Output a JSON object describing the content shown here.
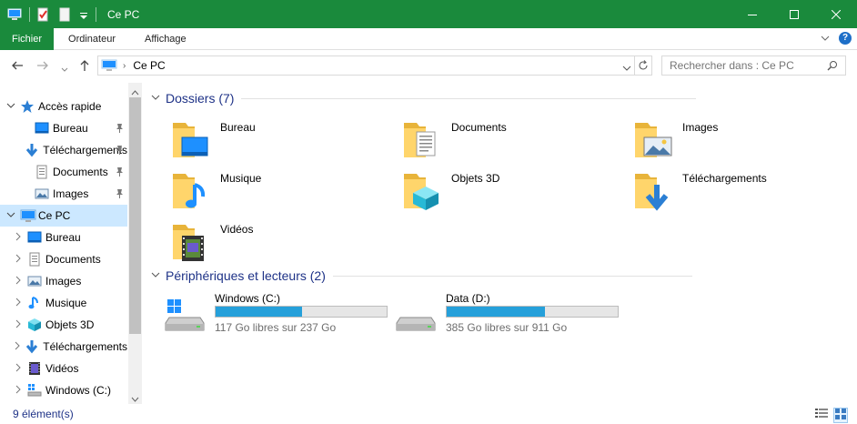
{
  "window": {
    "title": "Ce PC",
    "controls": [
      "minimize-icon",
      "maximize-icon",
      "close-icon"
    ]
  },
  "quick_access_toolbar": [
    "computer-icon",
    "properties-icon",
    "new-folder-icon",
    "customize-chevron-icon"
  ],
  "ribbon": {
    "tabs": [
      {
        "label": "Fichier",
        "active": true
      },
      {
        "label": "Ordinateur",
        "active": false
      },
      {
        "label": "Affichage",
        "active": false
      }
    ],
    "help": "?"
  },
  "address": {
    "path": "Ce PC",
    "search_placeholder": "Rechercher dans : Ce PC"
  },
  "nav": {
    "items": [
      {
        "label": "Accès rapide",
        "icon": "star-icon",
        "chevron": "v",
        "pinned": false,
        "indent": 0
      },
      {
        "label": "Bureau",
        "icon": "desktop-icon",
        "chevron": "",
        "pinned": true,
        "indent": 1
      },
      {
        "label": "Téléchargements",
        "icon": "download-icon",
        "chevron": "",
        "pinned": true,
        "indent": 1
      },
      {
        "label": "Documents",
        "icon": "document-icon",
        "chevron": "",
        "pinned": true,
        "indent": 1
      },
      {
        "label": "Images",
        "icon": "image-icon",
        "chevron": "",
        "pinned": true,
        "indent": 1
      },
      {
        "label": "Ce PC",
        "icon": "computer-icon",
        "chevron": "v",
        "pinned": false,
        "indent": 0,
        "selected": true
      },
      {
        "label": "Bureau",
        "icon": "desktop-icon",
        "chevron": ">",
        "pinned": false,
        "indent": 1
      },
      {
        "label": "Documents",
        "icon": "document-icon",
        "chevron": ">",
        "pinned": false,
        "indent": 1
      },
      {
        "label": "Images",
        "icon": "image-icon",
        "chevron": ">",
        "pinned": false,
        "indent": 1
      },
      {
        "label": "Musique",
        "icon": "music-icon",
        "chevron": ">",
        "pinned": false,
        "indent": 1
      },
      {
        "label": "Objets 3D",
        "icon": "cube-icon",
        "chevron": ">",
        "pinned": false,
        "indent": 1
      },
      {
        "label": "Téléchargements",
        "icon": "download-icon",
        "chevron": ">",
        "pinned": false,
        "indent": 1
      },
      {
        "label": "Vidéos",
        "icon": "video-icon",
        "chevron": ">",
        "pinned": false,
        "indent": 1
      },
      {
        "label": "Windows (C:)",
        "icon": "drive-icon",
        "chevron": ">",
        "pinned": false,
        "indent": 1
      }
    ]
  },
  "content": {
    "folders_header": "Dossiers (7)",
    "folders": [
      {
        "name": "Bureau",
        "icon": "desktop-folder-icon"
      },
      {
        "name": "Documents",
        "icon": "documents-folder-icon"
      },
      {
        "name": "Images",
        "icon": "images-folder-icon"
      },
      {
        "name": "Musique",
        "icon": "music-folder-icon"
      },
      {
        "name": "Objets 3D",
        "icon": "3d-objects-folder-icon"
      },
      {
        "name": "Téléchargements",
        "icon": "downloads-folder-icon"
      },
      {
        "name": "Vidéos",
        "icon": "videos-folder-icon"
      }
    ],
    "drives_header": "Périphériques et lecteurs (2)",
    "drives": [
      {
        "name": "Windows (C:)",
        "free": "117 Go libres sur 237 Go",
        "used_fraction": 0.506,
        "icon": "windows-drive-icon"
      },
      {
        "name": "Data (D:)",
        "free": "385 Go libres sur 911 Go",
        "used_fraction": 0.577,
        "icon": "data-drive-icon"
      }
    ]
  },
  "status": {
    "count": "9 élément(s)"
  },
  "colors": {
    "titlebar": "#1a8a3c",
    "selection": "#cce8ff",
    "group_header": "#1e3287",
    "progress": "#26a0da"
  }
}
